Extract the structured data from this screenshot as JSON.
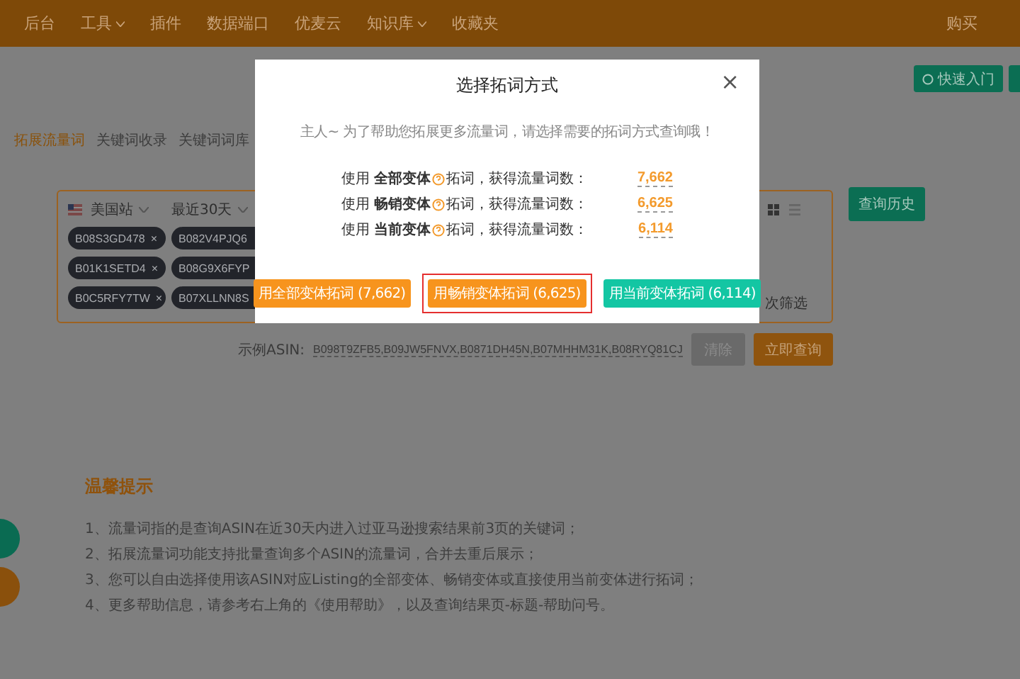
{
  "nav": {
    "items": [
      {
        "label": "后台",
        "dropdown": false
      },
      {
        "label": "工具",
        "dropdown": true
      },
      {
        "label": "插件",
        "dropdown": false
      },
      {
        "label": "数据端口",
        "dropdown": false
      },
      {
        "label": "优麦云",
        "dropdown": false
      },
      {
        "label": "知识库",
        "dropdown": true
      },
      {
        "label": "收藏夹",
        "dropdown": false
      }
    ],
    "right": [
      "购买"
    ]
  },
  "quick_start": {
    "label": "快速入门"
  },
  "tabs": [
    {
      "label": "拓展流量词",
      "selected": true
    },
    {
      "label": "关键词收录",
      "selected": false
    },
    {
      "label": "关键词词库",
      "selected": false
    }
  ],
  "search": {
    "site": "美国站",
    "period": "最近30天",
    "asins": [
      {
        "text": "B08S3GD478",
        "remove": "×"
      },
      {
        "text": "B082V4PJQ6"
      },
      {
        "text": "B01K1SETD4",
        "remove": "×"
      },
      {
        "text": "B08G9X6FYP"
      },
      {
        "text": "B0C5RFY7TW",
        "remove": "×"
      },
      {
        "text": "B07XLLNN8S"
      }
    ],
    "trailing_text": "次筛选",
    "history_button": "查询历史",
    "example_label": "示例ASIN:",
    "example_value": "B098T9ZFB5,B09JW5FNVX,B0871DH45N,B07MHHM31K,B08RYQ81CJ",
    "clear_button": "清除",
    "query_button": "立即查询"
  },
  "tips": {
    "title": "温馨提示",
    "items": [
      "1、流量词指的是查询ASIN在近30天内进入过亚马逊搜索结果前3页的关键词；",
      "2、拓展流量词功能支持批量查询多个ASIN的流量词，合并去重后展示；",
      "3、您可以自由选择使用该ASIN对应Listing的全部变体、畅销变体或直接使用当前变体进行拓词；",
      "4、更多帮助信息，请参考右上角的《使用帮助》，以及查询结果页-标题-帮助问号。"
    ]
  },
  "dialog": {
    "title": "选择拓词方式",
    "close": "×",
    "subtitle": "主人~ 为了帮助您拓展更多流量词，请选择需要的拓词方式查询哦！",
    "rows": [
      {
        "prefix": "使用 **全部变体** ",
        "suffix": "拓词，获得流量词数：",
        "count": "7,662"
      },
      {
        "prefix": "使用 **畅销变体** ",
        "suffix": "拓词，获得流量词数：",
        "count": "6,625"
      },
      {
        "prefix": "使用 **当前变体** ",
        "suffix": "拓词，获得流量词数：",
        "count": "6,114"
      }
    ],
    "buttons": [
      {
        "label": "用全部变体拓词 (7,662)",
        "color": "#f7941d",
        "highlighted": false
      },
      {
        "label": "用畅销变体拓词 (6,625)",
        "color": "#f7941d",
        "highlighted": true
      },
      {
        "label": "用当前变体拓词 (6,114)",
        "color": "#13c6a3",
        "highlighted": false
      }
    ]
  }
}
